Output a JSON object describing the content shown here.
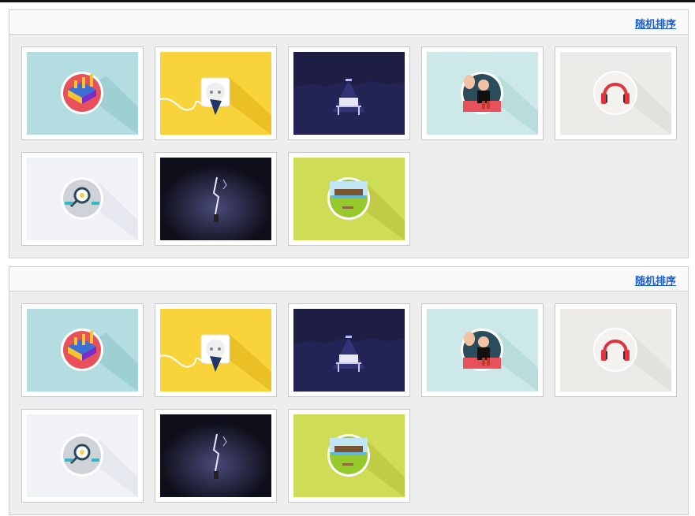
{
  "panels": [
    {
      "shuffle_label": "随机排序",
      "items": [
        {
          "icon": "isometric-building-icon",
          "bg": "#b3dde0"
        },
        {
          "icon": "power-plug-icon",
          "bg": "#f8d33a"
        },
        {
          "icon": "night-desk-lamp-icon",
          "bg": "#1e1d44"
        },
        {
          "icon": "waving-man-icon",
          "bg": "#cde8e8"
        },
        {
          "icon": "headphones-icon",
          "bg": "#ecebe7"
        },
        {
          "icon": "magnifier-gear-icon",
          "bg": "#f1f2f6"
        },
        {
          "icon": "lightning-figure-icon",
          "bg": "#0e0f1a"
        },
        {
          "icon": "landscape-badge-icon",
          "bg": "#cfdc55"
        }
      ]
    },
    {
      "shuffle_label": "随机排序",
      "items": [
        {
          "icon": "isometric-building-icon",
          "bg": "#b3dde0"
        },
        {
          "icon": "power-plug-icon",
          "bg": "#f8d33a"
        },
        {
          "icon": "night-desk-lamp-icon",
          "bg": "#1e1d44"
        },
        {
          "icon": "waving-man-icon",
          "bg": "#cde8e8"
        },
        {
          "icon": "headphones-icon",
          "bg": "#ecebe7"
        },
        {
          "icon": "magnifier-gear-icon",
          "bg": "#f1f2f6"
        },
        {
          "icon": "lightning-figure-icon",
          "bg": "#0e0f1a"
        },
        {
          "icon": "landscape-badge-icon",
          "bg": "#cfdc55"
        }
      ]
    }
  ],
  "colors": {
    "link": "#1a5fd6",
    "panel_bg": "#eeeeee",
    "panel_border": "#cfcfcf"
  }
}
